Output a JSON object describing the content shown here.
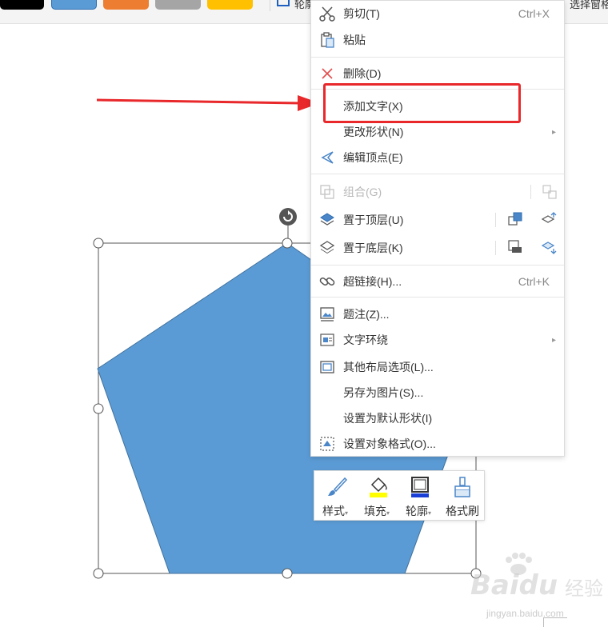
{
  "ribbon": {
    "outline_label": "轮廓",
    "select_label": "选择窗格",
    "swatches": [
      {
        "name": "black",
        "color": "#000000"
      },
      {
        "name": "blue",
        "color": "#5b9bd5"
      },
      {
        "name": "orange",
        "color": "#ed7d31"
      },
      {
        "name": "gray",
        "color": "#a5a5a5"
      },
      {
        "name": "gold",
        "color": "#ffc000"
      }
    ]
  },
  "shape": {
    "fill_color": "#5b9bd5",
    "stroke_color": "#41719c"
  },
  "annotation": {
    "arrow_color": "#e8282b"
  },
  "context_menu": {
    "cut": {
      "label": "剪切(T)",
      "shortcut": "Ctrl+X"
    },
    "paste": {
      "label": "粘贴"
    },
    "delete": {
      "label": "删除(D)"
    },
    "add_text": {
      "label": "添加文字(X)"
    },
    "change_shape": {
      "label": "更改形状(N)",
      "submenu_glyph": "▸"
    },
    "edit_points": {
      "label": "编辑顶点(E)"
    },
    "group": {
      "label": "组合(G)",
      "disabled": true
    },
    "bring_to_front": {
      "label": "置于顶层(U)"
    },
    "send_to_back": {
      "label": "置于底层(K)"
    },
    "hyperlink": {
      "label": "超链接(H)...",
      "shortcut": "Ctrl+K"
    },
    "caption": {
      "label": "题注(Z)..."
    },
    "text_wrap": {
      "label": "文字环绕",
      "submenu_glyph": "▸"
    },
    "layout_options": {
      "label": "其他布局选项(L)..."
    },
    "save_as_picture": {
      "label": "另存为图片(S)..."
    },
    "set_default_shape": {
      "label": "设置为默认形状(I)"
    },
    "format_object": {
      "label": "设置对象格式(O)..."
    }
  },
  "mini_toolbar": {
    "style": {
      "label": "样式",
      "caret": "▾"
    },
    "fill": {
      "label": "填充",
      "caret": "▾"
    },
    "outline": {
      "label": "轮廓",
      "caret": "▾"
    },
    "format_painter": {
      "label": "格式刷"
    }
  },
  "watermark": {
    "brand": "Baidu",
    "product": "经验",
    "url": "jingyan.baidu.com"
  }
}
